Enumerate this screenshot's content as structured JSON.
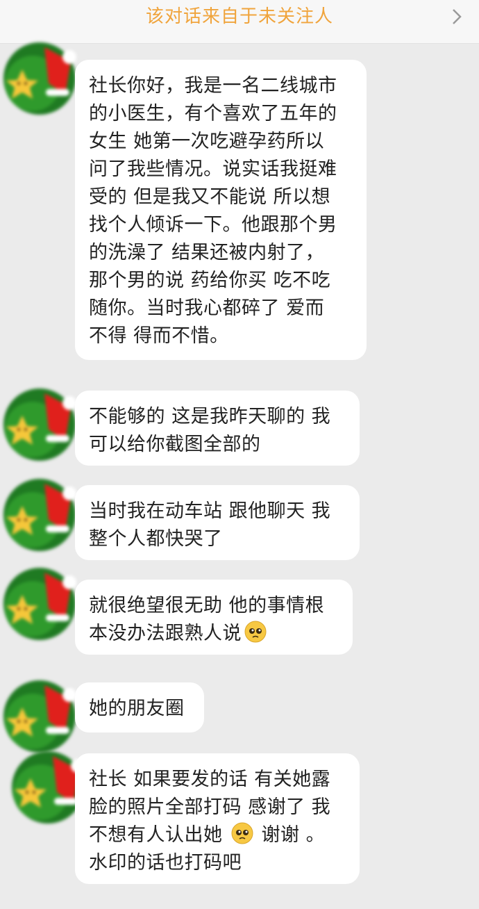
{
  "header": {
    "title": "该对话来自于未关注人"
  },
  "messages": [
    {
      "lines": [
        "社长你好，我是一名二线城市",
        "的小医生，有个喜欢了五年的",
        "女生 她第一次吃避孕药所以",
        "问了我些情况。说实话我挺难",
        "受的 但是我又不能说 所以想",
        "找个人倾诉一下。他跟那个男",
        "的洗澡了 结果还被内射了，",
        "那个男的说 药给你买 吃不吃",
        "随你。当时我心都碎了 爱而",
        "不得 得而不惜。"
      ]
    },
    {
      "lines": [
        "不能够的 这是我昨天聊的 我",
        "可以给你截图全部的"
      ]
    },
    {
      "lines": [
        "当时我在动车站 跟他聊天 我",
        "整个人都快哭了"
      ]
    },
    {
      "line1": "就很绝望很无助 他的事情根",
      "line2": "本没办法跟熟人说"
    },
    {
      "lines": [
        "她的朋友圈"
      ]
    },
    {
      "line1": "社长 如果要发的话 有关她露",
      "line2": "脸的照片全部打码 感谢了 我",
      "line3a": "不想有人认出她",
      "line3b": "谢谢 。",
      "line4": "水印的话也打码吧"
    }
  ],
  "icons": {
    "header_chevron": "chevron-right-icon",
    "avatar": "christmas-avatar-icon",
    "emoji": "pleading-face-emoji-icon"
  },
  "colors": {
    "header_title": "#f0a43c",
    "background": "#ebebeb",
    "bubble": "#ffffff"
  }
}
